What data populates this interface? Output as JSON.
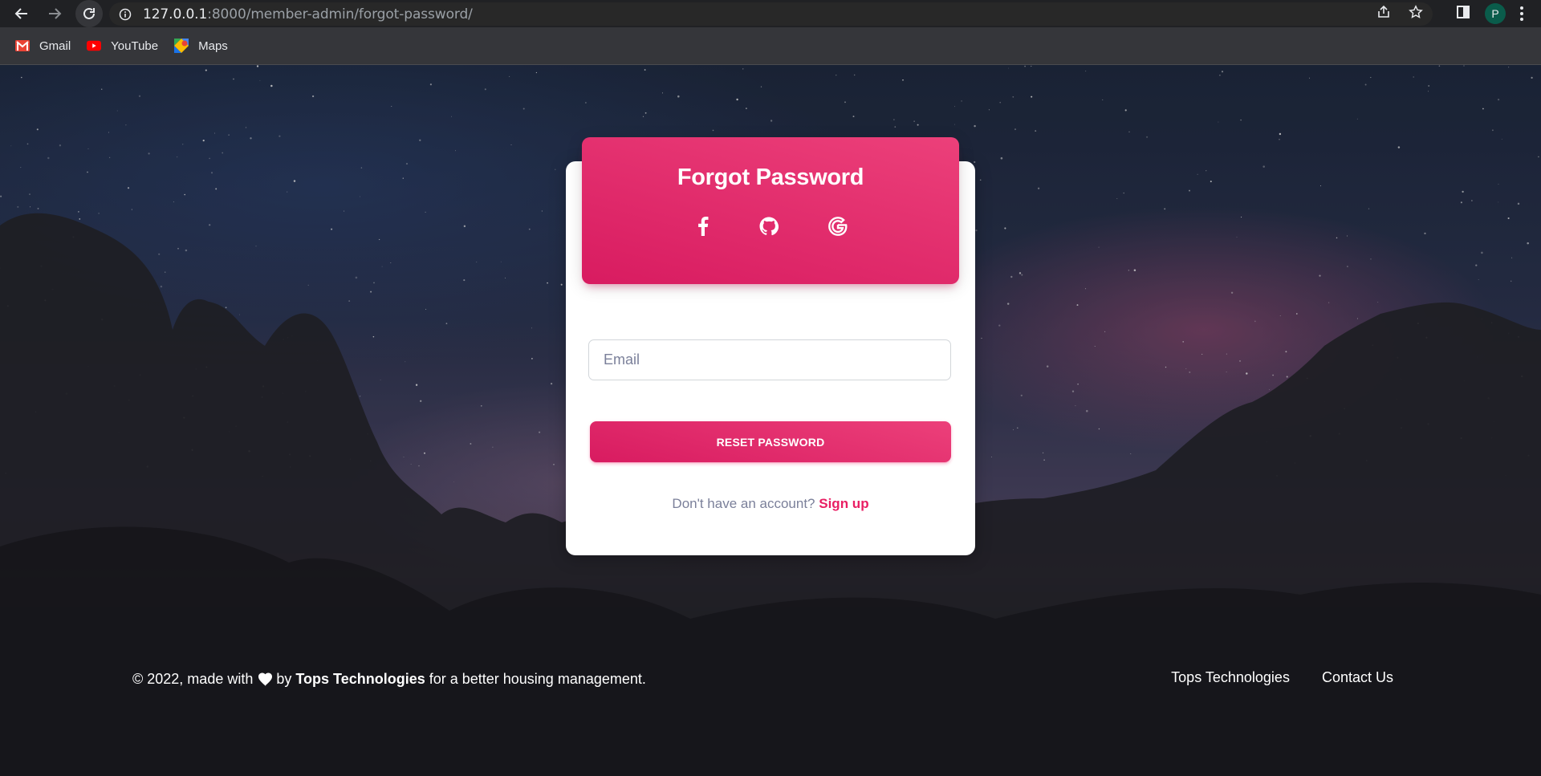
{
  "browser": {
    "url_host": "127.0.0.1",
    "url_path": ":8000/member-admin/forgot-password/",
    "profile_initial": "P",
    "bookmarks": [
      {
        "label": "Gmail",
        "icon": "gmail-icon"
      },
      {
        "label": "YouTube",
        "icon": "youtube-icon"
      },
      {
        "label": "Maps",
        "icon": "maps-icon"
      }
    ]
  },
  "card": {
    "title": "Forgot Password",
    "social_icons": [
      "facebook-icon",
      "github-icon",
      "google-icon"
    ],
    "email_placeholder": "Email",
    "reset_button_label": "RESET PASSWORD",
    "signup_prompt": "Don't have an account?",
    "signup_link": "Sign up"
  },
  "footer": {
    "copyright_prefix": "© 2022, made with",
    "by_text": "by",
    "company": "Tops Technologies",
    "copyright_suffix": "for a better housing management.",
    "links": [
      "Tops Technologies",
      "Contact Us"
    ]
  },
  "colors": {
    "accent": "#e91e63",
    "accent_gradient_start": "#ec407a",
    "accent_gradient_end": "#d81b60"
  }
}
